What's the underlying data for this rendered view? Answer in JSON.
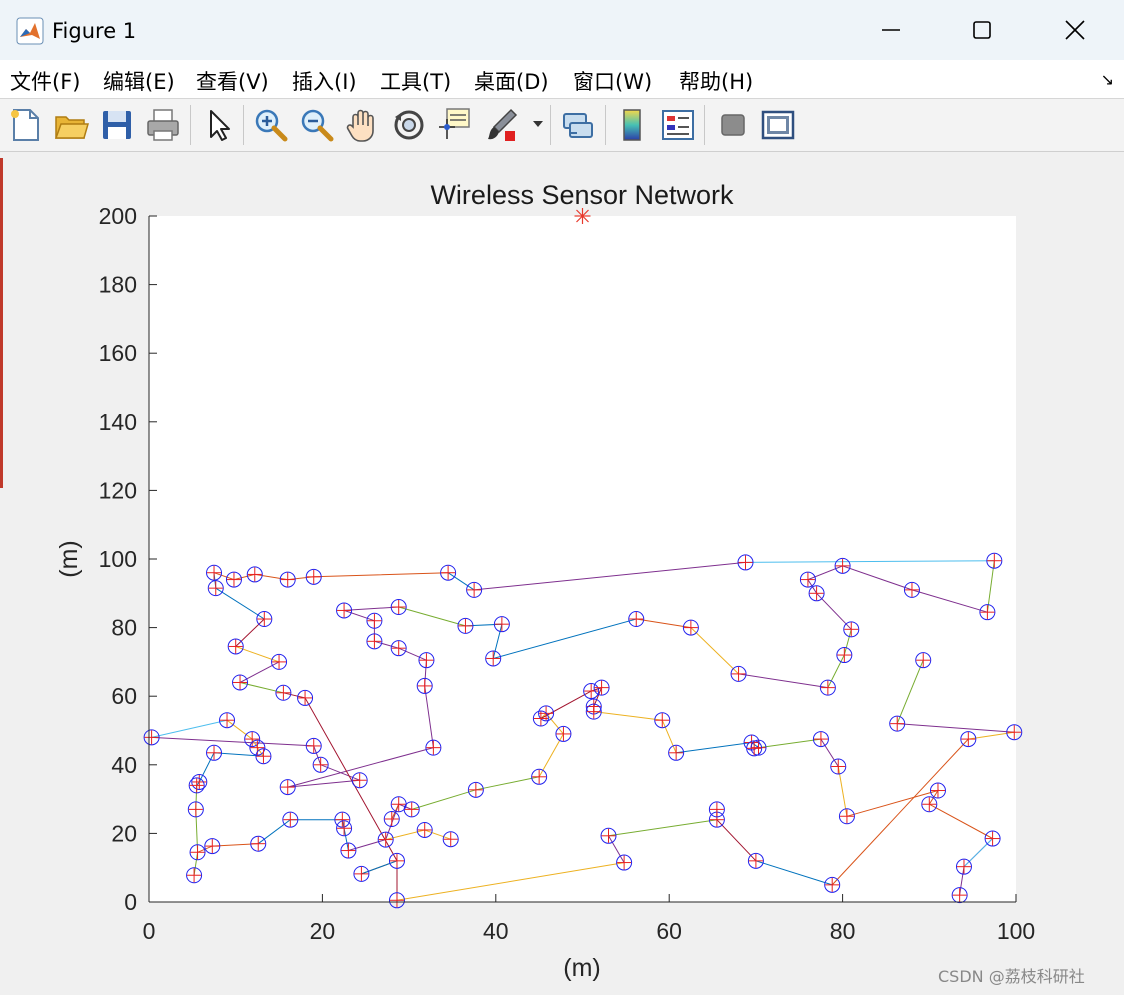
{
  "window": {
    "title": "Figure 1"
  },
  "menu": [
    "文件(F)",
    "编辑(E)",
    "查看(V)",
    "插入(I)",
    "工具(T)",
    "桌面(D)",
    "窗口(W)",
    "帮助(H)"
  ],
  "toolbar": [
    "new-figure-icon",
    "open-icon",
    "save-icon",
    "print-icon",
    "pointer-icon",
    "zoom-in-icon",
    "zoom-out-icon",
    "pan-icon",
    "rotate-icon",
    "data-cursor-icon",
    "brush-icon",
    "link-icon",
    "colorbar-icon",
    "legend-icon",
    "hide-plot-tools-icon",
    "show-plot-tools-icon"
  ],
  "watermark": "CSDN @荔枝科研社",
  "chart_data": {
    "type": "scatter",
    "title": "Wireless Sensor Network",
    "xlabel": "(m)",
    "ylabel": "(m)",
    "xlim": [
      0,
      100
    ],
    "ylim": [
      0,
      200
    ],
    "xticks": [
      0,
      20,
      40,
      60,
      80,
      100
    ],
    "yticks": [
      0,
      20,
      40,
      60,
      80,
      100,
      120,
      140,
      160,
      180,
      200
    ],
    "sink": {
      "x": 50,
      "y": 200,
      "color": "#e8392c"
    },
    "node_marker_color": "#2222ee",
    "node_cross_color": "#e82020",
    "paths": [
      {
        "color": "#d95319",
        "points": [
          [
            7.5,
            96
          ],
          [
            9.8,
            94
          ],
          [
            12.2,
            95.5
          ],
          [
            16,
            94
          ],
          [
            19,
            94.8
          ],
          [
            34.5,
            96
          ]
        ]
      },
      {
        "color": "#0072bd",
        "points": [
          [
            34.5,
            96
          ],
          [
            37.5,
            91
          ]
        ]
      },
      {
        "color": "#7e2f8e",
        "points": [
          [
            37.5,
            91
          ],
          [
            68.8,
            99
          ]
        ]
      },
      {
        "color": "#4dbeee",
        "points": [
          [
            68.8,
            99
          ],
          [
            97.5,
            99.5
          ]
        ]
      },
      {
        "color": "#77ac30",
        "points": [
          [
            97.5,
            99.5
          ],
          [
            96.7,
            84.5
          ]
        ]
      },
      {
        "color": "#7e2f8e",
        "points": [
          [
            96.7,
            84.5
          ],
          [
            88,
            91
          ],
          [
            80,
            98
          ],
          [
            76,
            94
          ],
          [
            77,
            90
          ],
          [
            81,
            79.5
          ]
        ]
      },
      {
        "color": "#77ac30",
        "points": [
          [
            81,
            79.5
          ],
          [
            80.2,
            72
          ],
          [
            78.3,
            62.5
          ]
        ]
      },
      {
        "color": "#7e2f8e",
        "points": [
          [
            78.3,
            62.5
          ],
          [
            68,
            66.5
          ]
        ]
      },
      {
        "color": "#edb120",
        "points": [
          [
            68,
            66.5
          ],
          [
            62.5,
            80
          ]
        ]
      },
      {
        "color": "#d95319",
        "points": [
          [
            62.5,
            80
          ],
          [
            56.2,
            82.5
          ]
        ]
      },
      {
        "color": "#0072bd",
        "points": [
          [
            56.2,
            82.5
          ],
          [
            39.7,
            71
          ],
          [
            40.7,
            81
          ],
          [
            36.5,
            80.5
          ]
        ]
      },
      {
        "color": "#77ac30",
        "points": [
          [
            36.5,
            80.5
          ],
          [
            28.8,
            86
          ]
        ]
      },
      {
        "color": "#7e2f8e",
        "points": [
          [
            28.8,
            86
          ],
          [
            22.5,
            85
          ],
          [
            26,
            82
          ],
          [
            26,
            76
          ],
          [
            28.8,
            74
          ],
          [
            32,
            70.5
          ],
          [
            31.8,
            63
          ],
          [
            32.8,
            45
          ]
        ]
      },
      {
        "color": "#7e2f8e",
        "points": [
          [
            32.8,
            45
          ],
          [
            16,
            33.5
          ],
          [
            24.3,
            35.5
          ],
          [
            19.8,
            40
          ],
          [
            19,
            45.5
          ],
          [
            0.3,
            48
          ]
        ]
      },
      {
        "color": "#4dbeee",
        "points": [
          [
            0.3,
            48
          ],
          [
            9,
            53
          ]
        ]
      },
      {
        "color": "#edb120",
        "points": [
          [
            9,
            53
          ],
          [
            11.9,
            47.5
          ],
          [
            12.5,
            45
          ],
          [
            13.2,
            42.5
          ]
        ]
      },
      {
        "color": "#0072bd",
        "points": [
          [
            13.2,
            42.5
          ],
          [
            7.5,
            43.5
          ],
          [
            5.8,
            35
          ],
          [
            5.5,
            34
          ]
        ]
      },
      {
        "color": "#77ac30",
        "points": [
          [
            5.5,
            34
          ],
          [
            5.4,
            27
          ],
          [
            5.6,
            14.5
          ],
          [
            5.2,
            7.8
          ]
        ]
      },
      {
        "color": "#d95319",
        "points": [
          [
            5.6,
            14.5
          ],
          [
            7.3,
            16.3
          ],
          [
            12.6,
            17
          ]
        ]
      },
      {
        "color": "#0072bd",
        "points": [
          [
            12.6,
            17
          ],
          [
            16.3,
            24
          ],
          [
            22.3,
            24
          ],
          [
            22.5,
            21.5
          ],
          [
            23,
            15
          ]
        ]
      },
      {
        "color": "#7e2f8e",
        "points": [
          [
            23,
            15
          ],
          [
            27.3,
            18.2
          ],
          [
            28.8,
            28.5
          ],
          [
            30.3,
            27
          ]
        ]
      },
      {
        "color": "#77ac30",
        "points": [
          [
            30.3,
            27
          ],
          [
            37.7,
            32.7
          ],
          [
            45,
            36.5
          ]
        ]
      },
      {
        "color": "#edb120",
        "points": [
          [
            45,
            36.5
          ],
          [
            47.8,
            49
          ],
          [
            45.8,
            55
          ],
          [
            45.2,
            53.5
          ]
        ]
      },
      {
        "color": "#a2142f",
        "points": [
          [
            45.2,
            53.5
          ],
          [
            51,
            61.5
          ],
          [
            52.2,
            62.5
          ],
          [
            51.3,
            57
          ],
          [
            51.3,
            55.5
          ]
        ]
      },
      {
        "color": "#edb120",
        "points": [
          [
            51.3,
            55.5
          ],
          [
            59.2,
            53
          ],
          [
            60.8,
            43.5
          ]
        ]
      },
      {
        "color": "#0072bd",
        "points": [
          [
            60.8,
            43.5
          ],
          [
            69.5,
            46.5
          ],
          [
            70.3,
            45
          ],
          [
            69.8,
            44.8
          ]
        ]
      },
      {
        "color": "#77ac30",
        "points": [
          [
            69.8,
            44.8
          ],
          [
            77.5,
            47.5
          ]
        ]
      },
      {
        "color": "#7e2f8e",
        "points": [
          [
            77.5,
            47.5
          ],
          [
            79.5,
            39.5
          ]
        ]
      },
      {
        "color": "#edb120",
        "points": [
          [
            79.5,
            39.5
          ],
          [
            80.5,
            25
          ]
        ]
      },
      {
        "color": "#d95319",
        "points": [
          [
            80.5,
            25
          ],
          [
            91,
            32.5
          ],
          [
            90,
            28.5
          ],
          [
            97.3,
            18.5
          ]
        ]
      },
      {
        "color": "#7e2f8e",
        "points": [
          [
            97.3,
            18.5
          ],
          [
            94,
            10.3
          ],
          [
            93.5,
            2
          ]
        ]
      },
      {
        "color": "#4dbeee",
        "points": [
          [
            94,
            10.3
          ],
          [
            97.3,
            18.5
          ]
        ]
      },
      {
        "color": "#77ac30",
        "points": [
          [
            86.3,
            52
          ],
          [
            89.3,
            70.5
          ]
        ]
      },
      {
        "color": "#7e2f8e",
        "points": [
          [
            86.3,
            52
          ],
          [
            99.8,
            49.5
          ]
        ]
      },
      {
        "color": "#edb120",
        "points": [
          [
            99.8,
            49.5
          ],
          [
            94.5,
            47.5
          ]
        ]
      },
      {
        "color": "#d95319",
        "points": [
          [
            94.5,
            47.5
          ],
          [
            78.8,
            5
          ]
        ]
      },
      {
        "color": "#0072bd",
        "points": [
          [
            78.8,
            5
          ],
          [
            70,
            12
          ]
        ]
      },
      {
        "color": "#a2142f",
        "points": [
          [
            70,
            12
          ],
          [
            65.5,
            24
          ],
          [
            65.5,
            27
          ]
        ]
      },
      {
        "color": "#77ac30",
        "points": [
          [
            65.5,
            24
          ],
          [
            53,
            19.3
          ]
        ]
      },
      {
        "color": "#7e2f8e",
        "points": [
          [
            53,
            19.3
          ],
          [
            54.8,
            11.5
          ]
        ]
      },
      {
        "color": "#edb120",
        "points": [
          [
            54.8,
            11.5
          ],
          [
            28.6,
            0.5
          ]
        ]
      },
      {
        "color": "#a2142f",
        "points": [
          [
            28.6,
            0.5
          ],
          [
            28.6,
            12
          ],
          [
            18,
            59.5
          ],
          [
            15.5,
            61
          ]
        ]
      },
      {
        "color": "#77ac30",
        "points": [
          [
            15.5,
            61
          ],
          [
            10.5,
            64
          ]
        ]
      },
      {
        "color": "#7e2f8e",
        "points": [
          [
            10.5,
            64
          ],
          [
            15,
            70
          ]
        ]
      },
      {
        "color": "#edb120",
        "points": [
          [
            15,
            70
          ],
          [
            10,
            74.5
          ]
        ]
      },
      {
        "color": "#a2142f",
        "points": [
          [
            10,
            74.5
          ],
          [
            13.3,
            82.5
          ]
        ]
      },
      {
        "color": "#0072bd",
        "points": [
          [
            13.3,
            82.5
          ],
          [
            7.7,
            91.5
          ],
          [
            7.5,
            96
          ]
        ]
      },
      {
        "color": "#d95319",
        "points": [
          [
            24.5,
            8.2
          ],
          [
            28.6,
            12
          ]
        ]
      },
      {
        "color": "#0072bd",
        "points": [
          [
            24.5,
            8.2
          ],
          [
            28.6,
            12
          ]
        ]
      },
      {
        "color": "#edb120",
        "points": [
          [
            27.3,
            18.2
          ],
          [
            31.8,
            21
          ],
          [
            34.8,
            18.3
          ]
        ]
      },
      {
        "color": "#d95319",
        "points": [
          [
            28,
            24.2
          ],
          [
            28.8,
            28.5
          ]
        ]
      }
    ],
    "nodes": [
      [
        7.5,
        96
      ],
      [
        7.7,
        91.5
      ],
      [
        9.8,
        94
      ],
      [
        12.2,
        95.5
      ],
      [
        16,
        94
      ],
      [
        19,
        94.8
      ],
      [
        34.5,
        96
      ],
      [
        37.5,
        91
      ],
      [
        68.8,
        99
      ],
      [
        97.5,
        99.5
      ],
      [
        96.7,
        84.5
      ],
      [
        88,
        91
      ],
      [
        80,
        98
      ],
      [
        76,
        94
      ],
      [
        77,
        90
      ],
      [
        81,
        79.5
      ],
      [
        80.2,
        72
      ],
      [
        78.3,
        62.5
      ],
      [
        68,
        66.5
      ],
      [
        62.5,
        80
      ],
      [
        56.2,
        82.5
      ],
      [
        39.7,
        71
      ],
      [
        40.7,
        81
      ],
      [
        36.5,
        80.5
      ],
      [
        28.8,
        86
      ],
      [
        22.5,
        85
      ],
      [
        26,
        82
      ],
      [
        26,
        76
      ],
      [
        28.8,
        74
      ],
      [
        32,
        70.5
      ],
      [
        31.8,
        63
      ],
      [
        32.8,
        45
      ],
      [
        16,
        33.5
      ],
      [
        24.3,
        35.5
      ],
      [
        19.8,
        40
      ],
      [
        19,
        45.5
      ],
      [
        0.3,
        48
      ],
      [
        9,
        53
      ],
      [
        11.9,
        47.5
      ],
      [
        12.5,
        45
      ],
      [
        13.2,
        42.5
      ],
      [
        7.5,
        43.5
      ],
      [
        5.8,
        35
      ],
      [
        5.5,
        34
      ],
      [
        5.4,
        27
      ],
      [
        5.6,
        14.5
      ],
      [
        5.2,
        7.8
      ],
      [
        7.3,
        16.3
      ],
      [
        12.6,
        17
      ],
      [
        16.3,
        24
      ],
      [
        22.3,
        24
      ],
      [
        22.5,
        21.5
      ],
      [
        23,
        15
      ],
      [
        27.3,
        18.2
      ],
      [
        28.8,
        28.5
      ],
      [
        30.3,
        27
      ],
      [
        28,
        24.2
      ],
      [
        31.8,
        21
      ],
      [
        34.8,
        18.3
      ],
      [
        37.7,
        32.7
      ],
      [
        45,
        36.5
      ],
      [
        47.8,
        49
      ],
      [
        45.8,
        55
      ],
      [
        45.2,
        53.5
      ],
      [
        51,
        61.5
      ],
      [
        52.2,
        62.5
      ],
      [
        51.3,
        57
      ],
      [
        51.3,
        55.5
      ],
      [
        59.2,
        53
      ],
      [
        60.8,
        43.5
      ],
      [
        69.5,
        46.5
      ],
      [
        70.3,
        45
      ],
      [
        69.8,
        44.8
      ],
      [
        77.5,
        47.5
      ],
      [
        79.5,
        39.5
      ],
      [
        80.5,
        25
      ],
      [
        91,
        32.5
      ],
      [
        90,
        28.5
      ],
      [
        97.3,
        18.5
      ],
      [
        94,
        10.3
      ],
      [
        93.5,
        2
      ],
      [
        86.3,
        52
      ],
      [
        89.3,
        70.5
      ],
      [
        99.8,
        49.5
      ],
      [
        94.5,
        47.5
      ],
      [
        78.8,
        5
      ],
      [
        70,
        12
      ],
      [
        65.5,
        24
      ],
      [
        65.5,
        27
      ],
      [
        53,
        19.3
      ],
      [
        54.8,
        11.5
      ],
      [
        28.6,
        0.5
      ],
      [
        28.6,
        12
      ],
      [
        24.5,
        8.2
      ],
      [
        18,
        59.5
      ],
      [
        15.5,
        61
      ],
      [
        10.5,
        64
      ],
      [
        15,
        70
      ],
      [
        10,
        74.5
      ],
      [
        13.3,
        82.5
      ]
    ]
  }
}
